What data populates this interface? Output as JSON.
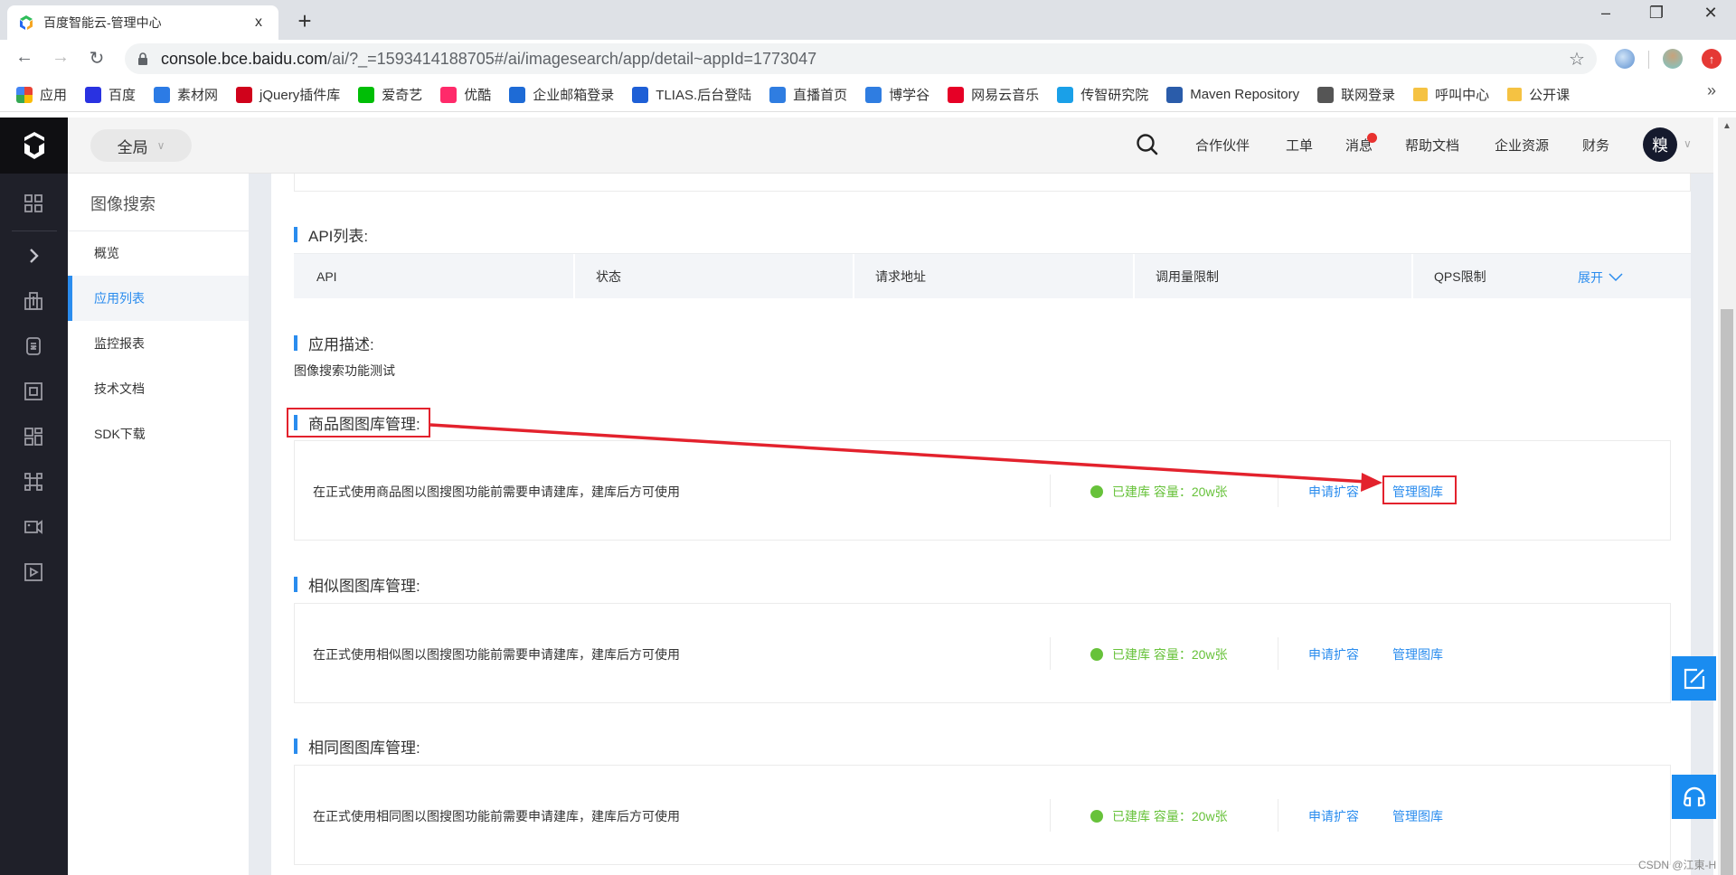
{
  "browser": {
    "tab_title": "百度智能云-管理中心",
    "tab_close": "x",
    "new_tab": "+",
    "window_controls": {
      "minimize": "–",
      "restore": "❐",
      "close": "✕"
    },
    "url_host": "console.bce.baidu.com",
    "url_path": "/ai/?_=1593414188705#/ai/imagesearch/app/detail~appId=1773047",
    "bookmarks": [
      {
        "label": "应用",
        "icon": "apps-grid-icon",
        "color": "#e94235"
      },
      {
        "label": "百度",
        "icon": "baidu-paw-icon",
        "color": "#2932e1"
      },
      {
        "label": "素材网",
        "icon": "sucai-icon",
        "color": "#2c7be5"
      },
      {
        "label": "jQuery插件库",
        "icon": "jquery-icon",
        "color": "#d0021b"
      },
      {
        "label": "爱奇艺",
        "icon": "iqiyi-icon",
        "color": "#00be06"
      },
      {
        "label": "优酷",
        "icon": "youku-icon",
        "color": "#ff2a6a"
      },
      {
        "label": "企业邮箱登录",
        "icon": "mail-cloud-icon",
        "color": "#1e6bd6"
      },
      {
        "label": "TLIAS.后台登陆",
        "icon": "tlias-icon",
        "color": "#1e5fd6"
      },
      {
        "label": "直播首页",
        "icon": "b-logo-icon",
        "color": "#2f7de1"
      },
      {
        "label": "博学谷",
        "icon": "b-logo-icon",
        "color": "#2f7de1"
      },
      {
        "label": "网易云音乐",
        "icon": "netease-music-icon",
        "color": "#e60026"
      },
      {
        "label": "传智研究院",
        "icon": "chuanzhi-icon",
        "color": "#1aa0e8"
      },
      {
        "label": "Maven Repository",
        "icon": "mvn-icon",
        "color": "#2a5caa"
      },
      {
        "label": "联网登录",
        "icon": "globe-icon",
        "color": "#555555"
      },
      {
        "label": "呼叫中心",
        "icon": "folder-icon",
        "color": "#f5c242"
      },
      {
        "label": "公开课",
        "icon": "folder-icon",
        "color": "#f5c242"
      }
    ],
    "bookmarks_more": "»"
  },
  "header": {
    "scope_label": "全局",
    "nav": [
      {
        "label": "合作伙伴"
      },
      {
        "label": "工单"
      },
      {
        "label": "消息",
        "has_badge": true
      },
      {
        "label": "帮助文档"
      },
      {
        "label": "企业资源"
      },
      {
        "label": "财务"
      }
    ],
    "avatar_text": "糗"
  },
  "sidebar_icons": [
    "dashboard-grid-icon",
    "expand-chevron-icon",
    "building-icon",
    "database-icon",
    "scan-frame-icon",
    "layout-blocks-icon",
    "command-icon",
    "video-camera-icon",
    "play-box-icon"
  ],
  "subnav": {
    "title": "图像搜索",
    "items": [
      {
        "label": "概览",
        "active": false
      },
      {
        "label": "应用列表",
        "active": true
      },
      {
        "label": "监控报表",
        "active": false
      },
      {
        "label": "技术文档",
        "active": false
      },
      {
        "label": "SDK下载",
        "active": false
      }
    ]
  },
  "content": {
    "api_section_title": "API列表:",
    "api_columns": [
      "API",
      "状态",
      "请求地址",
      "调用量限制",
      "QPS限制"
    ],
    "expand_label": "展开",
    "desc_section_title": "应用描述:",
    "description": "图像搜索功能测试",
    "libraries": [
      {
        "title": "商品图图库管理:",
        "text": "在正式使用商品图以图搜图功能前需要申请建库，建库后方可使用",
        "status": "已建库 容量：20w张",
        "apply_label": "申请扩容",
        "manage_label": "管理图库"
      },
      {
        "title": "相似图图库管理:",
        "text": "在正式使用相似图以图搜图功能前需要申请建库，建库后方可使用",
        "status": "已建库 容量：20w张",
        "apply_label": "申请扩容",
        "manage_label": "管理图库"
      },
      {
        "title": "相同图图库管理:",
        "text": "在正式使用相同图以图搜图功能前需要申请建库，建库后方可使用",
        "status": "已建库 容量：20w张",
        "apply_label": "申请扩容",
        "manage_label": "管理图库"
      }
    ]
  },
  "colors": {
    "accent": "#2a8cee",
    "status_ok": "#67c23a",
    "annotation": "#e3222d",
    "sidebar_dark": "#1f2029"
  },
  "watermark": "CSDN @江東-H"
}
